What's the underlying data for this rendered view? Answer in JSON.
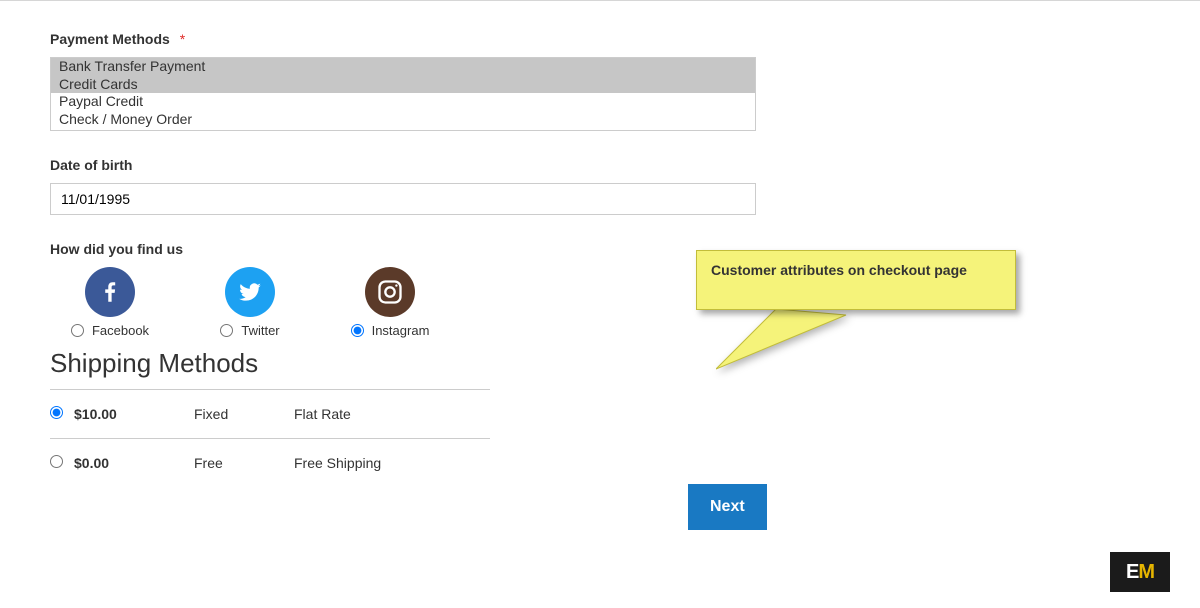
{
  "payment_methods": {
    "label": "Payment Methods",
    "required_mark": "*",
    "options": [
      "Bank Transfer Payment",
      "Credit Cards",
      "Paypal Credit",
      "Check / Money Order"
    ],
    "selected_indices": [
      0,
      1
    ]
  },
  "dob": {
    "label": "Date of birth",
    "value": "11/01/1995"
  },
  "find_us": {
    "label": "How did you find us",
    "options": [
      {
        "id": "facebook",
        "label": "Facebook",
        "icon": "facebook-icon",
        "selected": false
      },
      {
        "id": "twitter",
        "label": "Twitter",
        "icon": "twitter-icon",
        "selected": false
      },
      {
        "id": "instagram",
        "label": "Instagram",
        "icon": "instagram-icon",
        "selected": true
      }
    ]
  },
  "shipping": {
    "heading": "Shipping Methods",
    "rows": [
      {
        "price": "$10.00",
        "type": "Fixed",
        "carrier": "Flat Rate",
        "selected": true
      },
      {
        "price": "$0.00",
        "type": "Free",
        "carrier": "Free Shipping",
        "selected": false
      }
    ]
  },
  "next_button_label": "Next",
  "callout_text": "Customer attributes on checkout page",
  "logo": {
    "e": "E",
    "m": "M"
  }
}
